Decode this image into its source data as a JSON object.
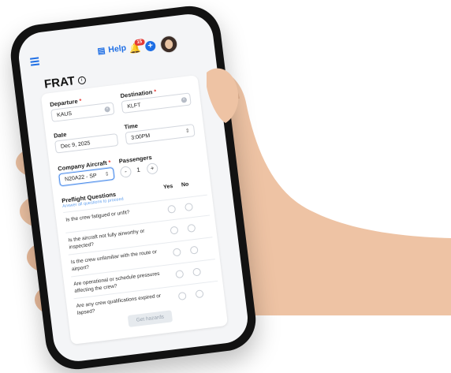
{
  "topbar": {
    "help_label": "Help",
    "notification_count": "15"
  },
  "page": {
    "title": "FRAT"
  },
  "form": {
    "departure": {
      "label": "Departure",
      "required_mark": "*",
      "value": "KAUS"
    },
    "destination": {
      "label": "Destination",
      "required_mark": "*",
      "value": "KLFT"
    },
    "date": {
      "label": "Date",
      "value": "Dec 9, 2025"
    },
    "time": {
      "label": "Time",
      "value": "3:00PM"
    },
    "aircraft": {
      "label": "Company Aircraft",
      "required_mark": "*",
      "value": "N20A22 - SP"
    },
    "passengers": {
      "label": "Passengers",
      "value": "1",
      "minus": "-",
      "plus": "+"
    }
  },
  "preflight": {
    "title": "Preflight Questions",
    "subtitle": "Answer all questions to proceed",
    "yes_label": "Yes",
    "no_label": "No",
    "questions": [
      {
        "text": "Is the crew fatigued or unfit?"
      },
      {
        "text": "Is the aircraft not fully airworthy or inspected?"
      },
      {
        "text": "Is the crew unfamiliar with the route or airport?"
      },
      {
        "text": "Are operational or schedule pressures affecting the crew?"
      },
      {
        "text": "Are any crew qualifications expired or lapsed?"
      }
    ]
  },
  "actions": {
    "get_hazards_label": "Get hazards"
  },
  "colors": {
    "accent": "#1f6fe5",
    "required": "#e53935",
    "phone_frame": "#121212"
  }
}
